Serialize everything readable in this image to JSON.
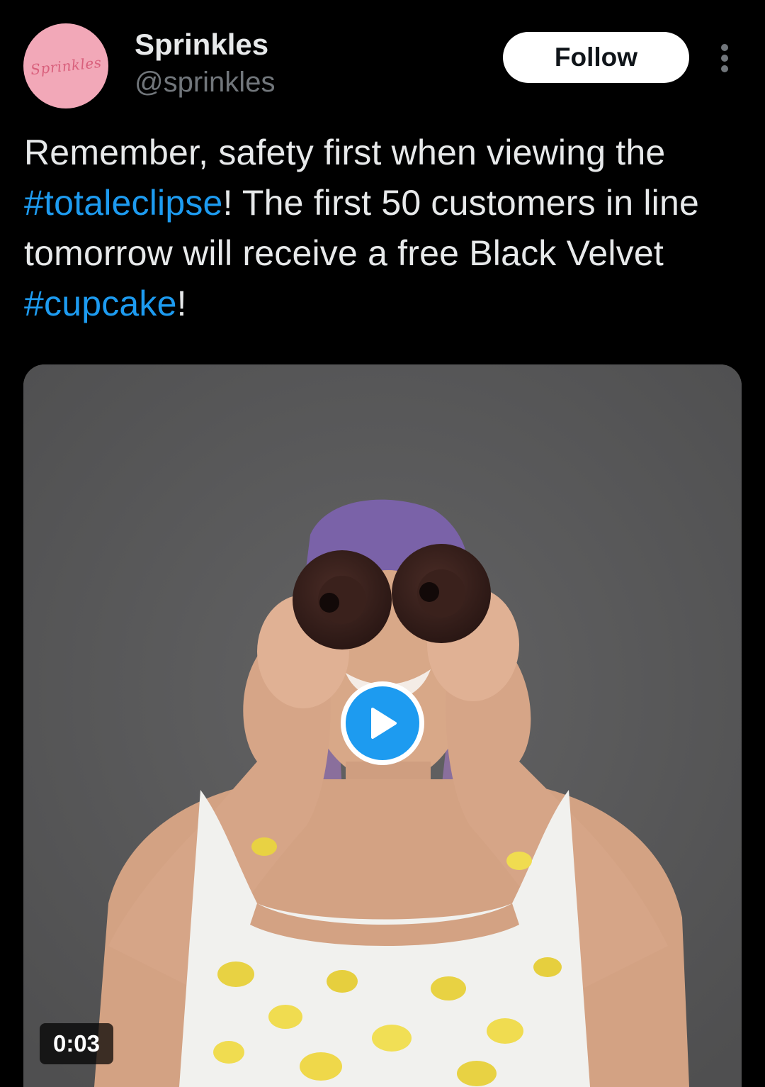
{
  "author": {
    "name": "Sprinkles",
    "handle": "@sprinkles",
    "avatar_logo_text": "Sprinkles"
  },
  "actions": {
    "follow_label": "Follow",
    "more_icon": "more-vertical-icon"
  },
  "tweet": {
    "text_parts": {
      "p1": "Remember, safety first when viewing the ",
      "tag1": "#totaleclipse",
      "p2": "! The first 50 customers in line tomorrow will receive a free Black Velvet ",
      "tag2": "#cupcake",
      "p3": "!"
    }
  },
  "media": {
    "type": "video",
    "duration": "0:03",
    "play_icon": "play-icon",
    "description": "Woman with purple hair holding two chocolate cupcakes up to her eyes like binoculars"
  },
  "colors": {
    "background": "#000000",
    "text": "#e7e9ea",
    "secondary_text": "#71767b",
    "link": "#1d9bf0",
    "avatar_bg": "#f2a8b8"
  }
}
